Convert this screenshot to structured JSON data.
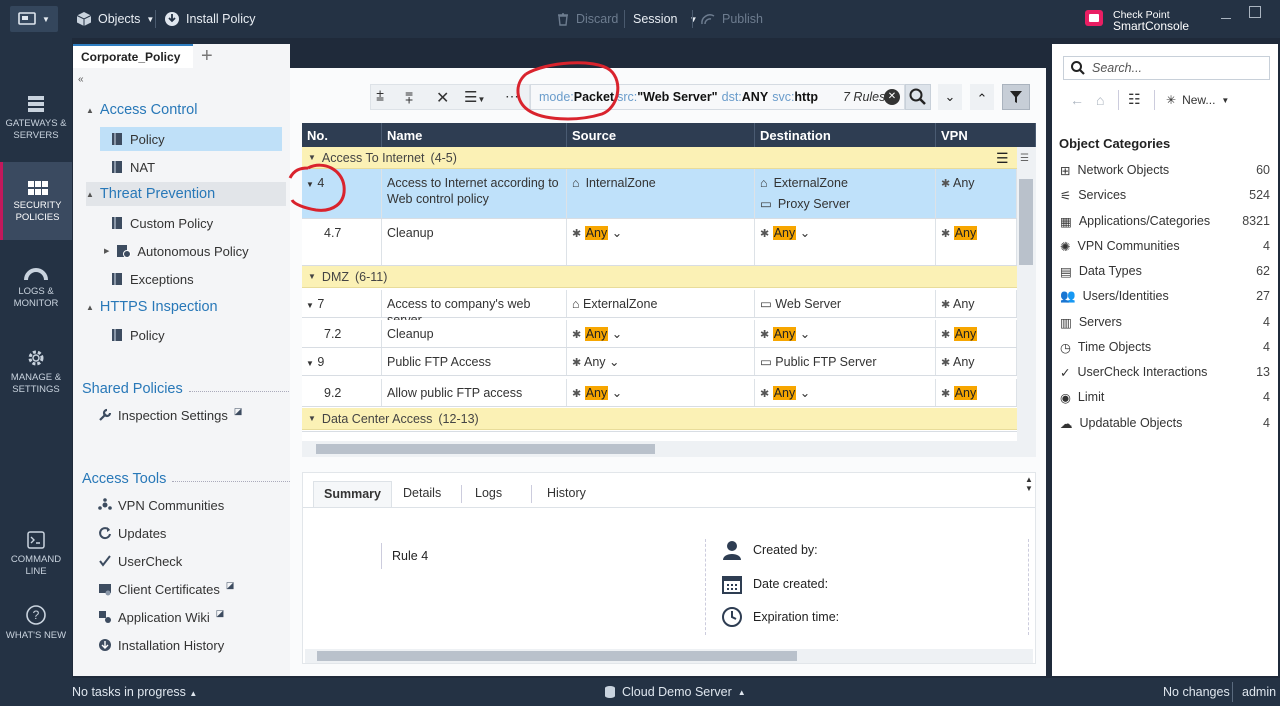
{
  "topbar": {
    "objects_label": "Objects",
    "install_policy_label": "Install Policy",
    "discard_label": "Discard",
    "session_label": "Session",
    "publish_label": "Publish",
    "brand_line1": "Check Point",
    "brand_line2": "SmartConsole"
  },
  "leftnav": {
    "gateways": "GATEWAYS & SERVERS",
    "security": "SECURITY POLICIES",
    "logs": "LOGS & MONITOR",
    "manage": "MANAGE & SETTINGS",
    "cmd": "COMMAND LINE",
    "whatsnew": "WHAT'S NEW"
  },
  "tree": {
    "tab_label": "Corporate_Policy",
    "access_control": "Access Control",
    "policy": "Policy",
    "nat": "NAT",
    "threat_prevention": "Threat Prevention",
    "custom_policy": "Custom Policy",
    "autonomous_policy": "Autonomous Policy",
    "exceptions": "Exceptions",
    "https_inspection": "HTTPS Inspection",
    "https_policy": "Policy",
    "shared_policies": "Shared Policies",
    "inspection_settings": "Inspection Settings",
    "access_tools": "Access Tools",
    "vpn_communities": "VPN Communities",
    "updates": "Updates",
    "usercheck": "UserCheck",
    "client_certificates": "Client Certificates",
    "application_wiki": "Application Wiki",
    "installation_history": "Installation History"
  },
  "search": {
    "mode_key": "mode:",
    "mode_val": "Packet",
    "src_key": "src:",
    "src_val": "\"Web Server\"",
    "dst_key": "dst:",
    "dst_val": "ANY",
    "svc_key": "svc:",
    "svc_val": "http",
    "count": "7 Rules"
  },
  "columns": {
    "no": "No.",
    "name": "Name",
    "source": "Source",
    "destination": "Destination",
    "vpn": "VPN"
  },
  "sections": [
    {
      "name": "Access To Internet",
      "range": "(4-5)"
    },
    {
      "name": "DMZ",
      "range": "(6-11)"
    },
    {
      "name": "Data Center Access",
      "range": "(12-13)"
    }
  ],
  "rows": [
    {
      "no": "4",
      "name": "Access to Internet according to Web control policy",
      "src": "InternalZone",
      "dst1": "ExternalZone",
      "dst2": "Proxy Server",
      "vpn": "Any"
    },
    {
      "no": "4.7",
      "name": "Cleanup",
      "src": "Any",
      "dst": "Any",
      "vpn": "Any"
    },
    {
      "no": "7",
      "name": "Access to company's web server",
      "src": "ExternalZone",
      "dst": "Web Server",
      "vpn": "Any"
    },
    {
      "no": "7.2",
      "name": "Cleanup",
      "src": "Any",
      "dst": "Any",
      "vpn": "Any"
    },
    {
      "no": "9",
      "name": "Public FTP Access",
      "src": "Any",
      "dst": "Public FTP Server",
      "vpn": "Any"
    },
    {
      "no": "9.2",
      "name": "Allow public FTP access",
      "src": "Any",
      "dst": "Any",
      "vpn": "Any"
    }
  ],
  "details": {
    "tabs": [
      "Summary",
      "Details",
      "Logs",
      "History"
    ],
    "rule_label": "Rule",
    "rule_no": "4",
    "created_by": "Created by:",
    "date_created": "Date created:",
    "expiration": "Expiration time:"
  },
  "right": {
    "search_placeholder": "Search...",
    "new_label": "New...",
    "categories_title": "Object Categories",
    "categories": [
      {
        "name": "Network Objects",
        "count": "60"
      },
      {
        "name": "Services",
        "count": "524"
      },
      {
        "name": "Applications/Categories",
        "count": "8321"
      },
      {
        "name": "VPN Communities",
        "count": "4"
      },
      {
        "name": "Data Types",
        "count": "62"
      },
      {
        "name": "Users/Identities",
        "count": "27"
      },
      {
        "name": "Servers",
        "count": "4"
      },
      {
        "name": "Time Objects",
        "count": "4"
      },
      {
        "name": "UserCheck Interactions",
        "count": "13"
      },
      {
        "name": "Limit",
        "count": "4"
      },
      {
        "name": "Updatable Objects",
        "count": "4"
      }
    ]
  },
  "status": {
    "tasks": "No tasks in progress",
    "server": "Cloud Demo Server",
    "changes": "No changes",
    "user": "admin"
  },
  "colors": {
    "accent": "#2f7ec1",
    "highlight": "#f7a600",
    "annotation": "#d9232d",
    "section": "#fbf1b5"
  }
}
